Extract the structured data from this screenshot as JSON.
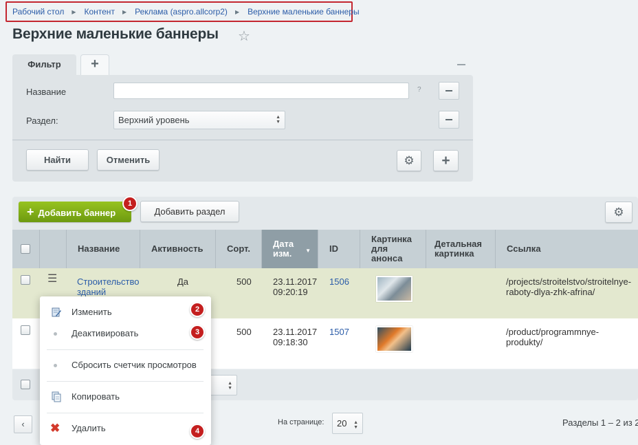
{
  "breadcrumb": [
    "Рабочий стол",
    "Контент",
    "Реклама (aspro.allcorp2)",
    "Верхние маленькие баннеры"
  ],
  "page": {
    "title": "Верхние маленькие баннеры"
  },
  "filter": {
    "tab_label": "Фильтр",
    "fields": [
      {
        "label": "Название",
        "value": ""
      },
      {
        "label": "Раздел:",
        "value": "Верхний уровень"
      }
    ],
    "help_glyph": "?",
    "find_label": "Найти",
    "cancel_label": "Отменить"
  },
  "toolbar": {
    "add_banner_label": "Добавить баннер",
    "add_section_label": "Добавить раздел"
  },
  "table": {
    "columns": [
      "Название",
      "Активность",
      "Сорт.",
      "Дата изм.",
      "ID",
      "Картинка для анонса",
      "Детальная картинка",
      "Ссылка"
    ],
    "sorted_column": "Дата изм.",
    "rows": [
      {
        "name": "Строительство зданий",
        "active": "Да",
        "sort": "500",
        "date": "23.11.2017",
        "time": "09:20:19",
        "id": "1506",
        "link": "/projects/stroitelstvo/stroitelnye-raboty-dlya-zhk-afrina/"
      },
      {
        "name": "",
        "active": "",
        "sort": "500",
        "date": "23.11.2017",
        "time": "09:18:30",
        "id": "1507",
        "link": "/product/programmnye-produkty/"
      }
    ]
  },
  "context_menu": [
    {
      "label": "Изменить",
      "icon": "edit-icon"
    },
    {
      "label": "Деактивировать",
      "icon": "bullet-icon"
    },
    {
      "label": "Сбросить счетчик просмотров",
      "icon": "bullet-icon"
    },
    {
      "label": "Копировать",
      "icon": "copy-icon"
    },
    {
      "label": "Удалить",
      "icon": "delete-icon"
    }
  ],
  "badges": [
    "1",
    "2",
    "3",
    "4"
  ],
  "footer": {
    "per_page_label": "На странице:",
    "per_page_value": "20",
    "total": "Разделы 1 – 2 из 2"
  },
  "colors": {
    "accent_green": "#7aa714",
    "badge_red": "#c41f1f",
    "link_blue": "#2b5ca8"
  }
}
